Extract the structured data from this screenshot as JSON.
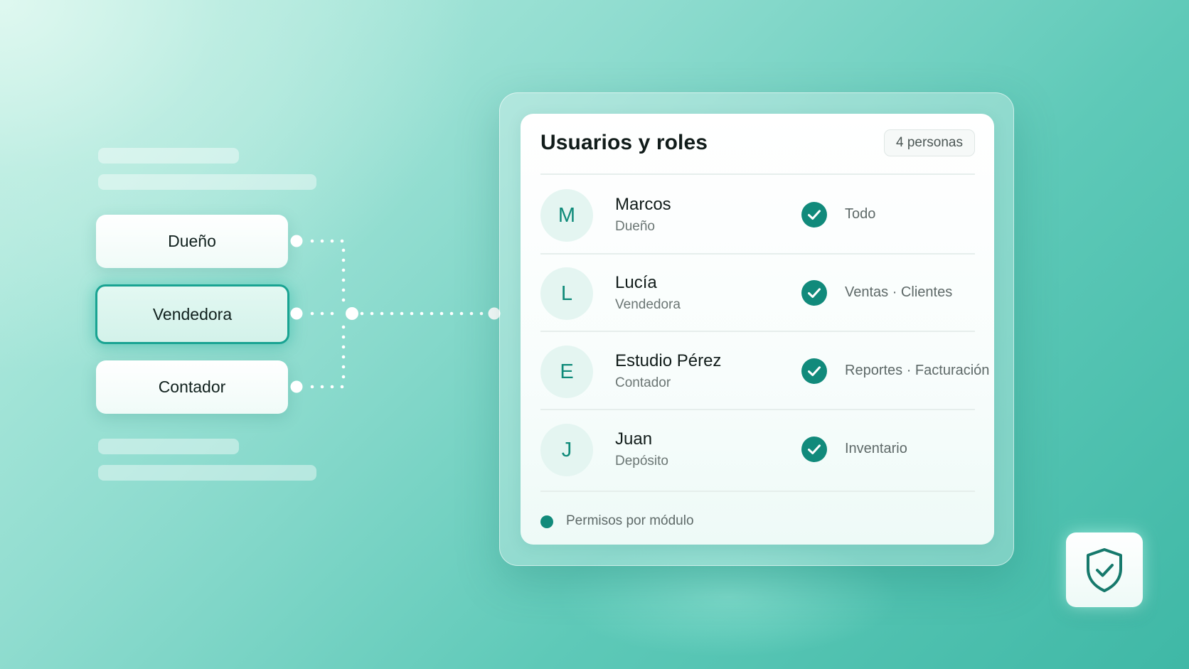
{
  "roles": [
    {
      "label": "Dueño",
      "selected": false
    },
    {
      "label": "Vendedora",
      "selected": true
    },
    {
      "label": "Contador",
      "selected": false
    }
  ],
  "panel": {
    "title": "Usuarios y roles",
    "count_badge": "4 personas",
    "users": [
      {
        "initial": "M",
        "name": "Marcos",
        "role": "Dueño",
        "permissions": "Todo",
        "status_icon": "check-circle-icon"
      },
      {
        "initial": "L",
        "name": "Lucía",
        "role": "Vendedora",
        "permissions": "Ventas · Clientes",
        "status_icon": "check-circle-icon"
      },
      {
        "initial": "E",
        "name": "Estudio Pérez",
        "role": "Contador",
        "permissions": "Reportes · Facturación",
        "status_icon": "check-circle-icon"
      },
      {
        "initial": "J",
        "name": "Juan",
        "role": "Depósito",
        "permissions": "Inventario",
        "status_icon": "check-circle-icon"
      }
    ],
    "footer": "Permisos por módulo"
  },
  "shield_icon": "shield-check-icon",
  "colors": {
    "accent": "#118a7b",
    "accent_light": "#e4f5f1",
    "selected_border": "#19a392"
  }
}
